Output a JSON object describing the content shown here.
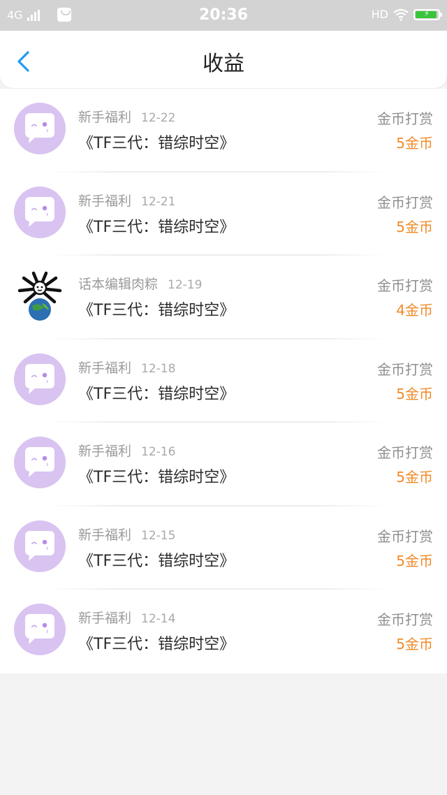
{
  "status_bar": {
    "network": "4G",
    "time": "20:36",
    "hd": "HD"
  },
  "header": {
    "title": "收益",
    "back_icon": "chevron-left-icon"
  },
  "colors": {
    "accent": "#1e9cf0",
    "amount": "#f08a28",
    "avatar_bg": "#d8c3f1"
  },
  "items": [
    {
      "source": "新手福利",
      "date": "12-22",
      "title": "《TF三代：错综时空》",
      "type": "金币打赏",
      "amount": "5金币",
      "avatar": "chat-bubble-avatar"
    },
    {
      "source": "新手福利",
      "date": "12-21",
      "title": "《TF三代：错综时空》",
      "type": "金币打赏",
      "amount": "5金币",
      "avatar": "chat-bubble-avatar"
    },
    {
      "source": "话本编辑肉粽",
      "date": "12-19",
      "title": "《TF三代：错综时空》",
      "type": "金币打赏",
      "amount": "4金币",
      "avatar": "meme-avatar"
    },
    {
      "source": "新手福利",
      "date": "12-18",
      "title": "《TF三代：错综时空》",
      "type": "金币打赏",
      "amount": "5金币",
      "avatar": "chat-bubble-avatar"
    },
    {
      "source": "新手福利",
      "date": "12-16",
      "title": "《TF三代：错综时空》",
      "type": "金币打赏",
      "amount": "5金币",
      "avatar": "chat-bubble-avatar"
    },
    {
      "source": "新手福利",
      "date": "12-15",
      "title": "《TF三代：错综时空》",
      "type": "金币打赏",
      "amount": "5金币",
      "avatar": "chat-bubble-avatar"
    },
    {
      "source": "新手福利",
      "date": "12-14",
      "title": "《TF三代：错综时空》",
      "type": "金币打赏",
      "amount": "5金币",
      "avatar": "chat-bubble-avatar"
    }
  ]
}
